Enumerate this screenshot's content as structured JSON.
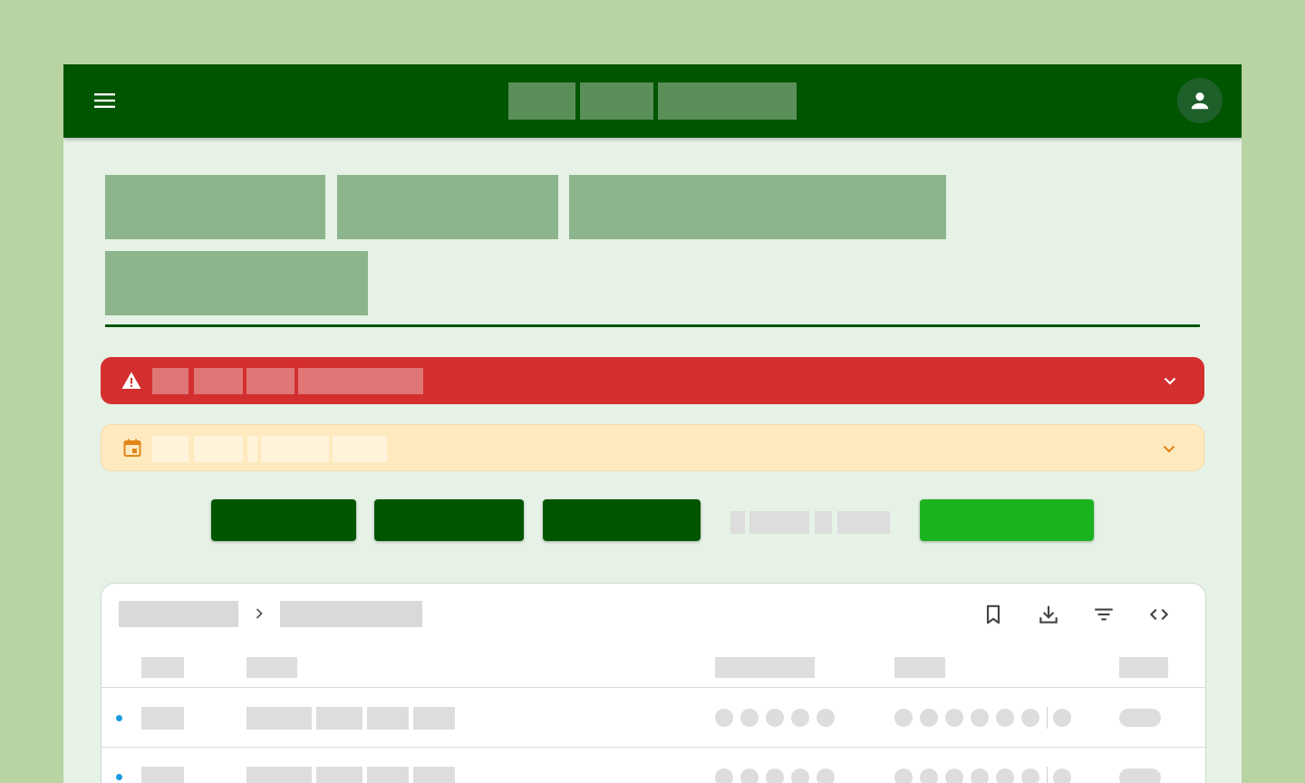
{
  "theme": {
    "page_background": "#b8d4a2",
    "frame_background": "#e6f2e6",
    "header_background": "#005500",
    "alert_color": "#d32f2f",
    "notice_color": "#ffeabf",
    "primary_button_color": "#005500",
    "accent_button_color": "#1bb21f",
    "row_indicator_color": "#1a9be0"
  },
  "header": {
    "menu_icon": "hamburger-menu-icon",
    "account_icon": "account-circle-icon"
  },
  "alert_banner": {
    "icon": "warning-triangle-icon",
    "expand_icon": "chevron-down-icon"
  },
  "notice_banner": {
    "icon": "calendar-icon",
    "expand_icon": "chevron-down-icon"
  },
  "card": {
    "breadcrumb_separator_icon": "chevron-right-icon",
    "toolbar_icons": [
      "bookmark-icon",
      "download-icon",
      "filter-icon",
      "code-icon"
    ],
    "row_count_visible": 2
  }
}
